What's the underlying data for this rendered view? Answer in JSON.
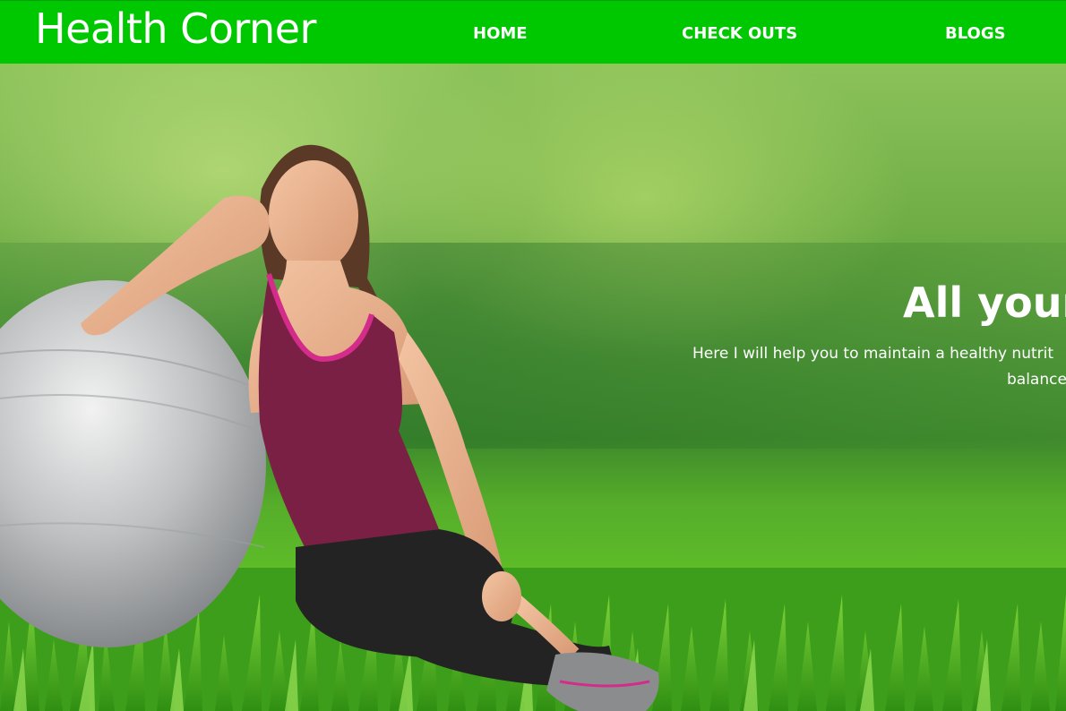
{
  "brand": {
    "name": "Health Corner"
  },
  "nav": {
    "links": [
      {
        "label": "HOME"
      },
      {
        "label": "CHECK OUTS"
      },
      {
        "label": "BLOGS"
      }
    ]
  },
  "hero": {
    "title": "All your",
    "subtitle_line1": "Here I will help you to maintain a healthy nutrit",
    "subtitle_line2": "balance"
  },
  "colors": {
    "navbar_bg": "#00c800",
    "nav_text": "#ffffff"
  }
}
